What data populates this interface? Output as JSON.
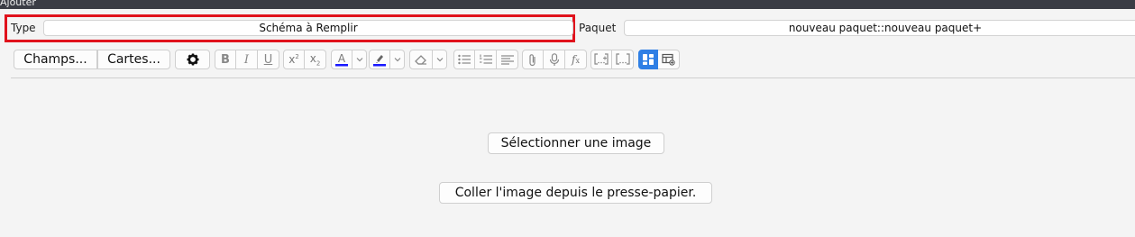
{
  "window": {
    "title": "Ajouter"
  },
  "note_type": {
    "label": "Type",
    "value": "Schéma à Remplir"
  },
  "deck": {
    "label": "Paquet",
    "value": "nouveau paquet::nouveau paquet+"
  },
  "toolbar": {
    "fields_label": "Champs...",
    "cards_label": "Cartes...",
    "superscript_badge": "2",
    "subscript_badge": "2",
    "text_color": "#1a1aff",
    "highlight_color": "#1a1aff",
    "active_color": "#2f7fe5",
    "icons": [
      "gear-icon",
      "bold-icon",
      "italic-icon",
      "underline-icon",
      "superscript-icon",
      "subscript-icon",
      "text-color-icon",
      "highlight-icon",
      "eraser-icon",
      "bullet-list-icon",
      "numbered-list-icon",
      "align-icon",
      "attach-icon",
      "microphone-icon",
      "function-icon",
      "cloze-icon",
      "cloze-same-icon",
      "image-occlusion-icon",
      "table-toggle-icon"
    ]
  },
  "image_occlusion": {
    "select_image_label": "Sélectionner une image",
    "paste_image_label": "Coller l'image depuis le presse-papier."
  }
}
